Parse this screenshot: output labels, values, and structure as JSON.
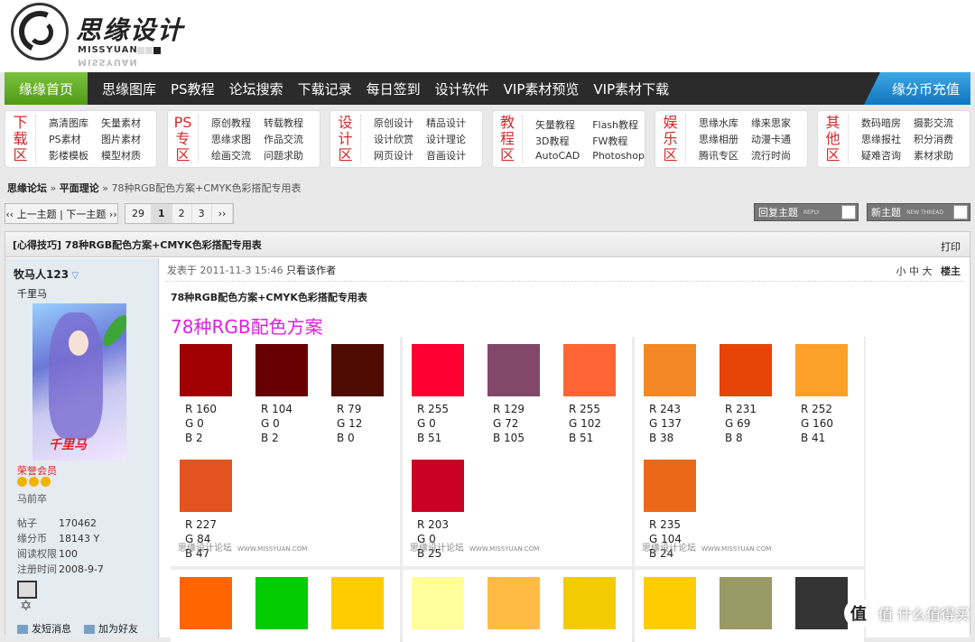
{
  "logo": {
    "cn": "思缘设计",
    "en": "MISSYUAN"
  },
  "nav": {
    "home": "缘缘首页",
    "items": [
      "思缘图库",
      "PS教程",
      "论坛搜索",
      "下载记录",
      "每日签到",
      "设计软件",
      "VIP素材预览",
      "VIP素材下载"
    ],
    "recharge": "缘分币充值"
  },
  "subnav": [
    {
      "title": [
        "下",
        "载",
        "区"
      ],
      "links": [
        "高清图库",
        "矢量素材",
        "PS素材",
        "图片素材",
        "影楼模板",
        "模型材质"
      ]
    },
    {
      "title": [
        "PS",
        "专",
        "区"
      ],
      "links": [
        "原创教程",
        "转载教程",
        "思缘求图",
        "作品交流",
        "绘画交流",
        "问题求助"
      ]
    },
    {
      "title": [
        "设",
        "计",
        "区"
      ],
      "links": [
        "原创设计",
        "精品设计",
        "设计欣赏",
        "设计理论",
        "网页设计",
        "音画设计"
      ]
    },
    {
      "title": [
        "教",
        "程",
        "区"
      ],
      "links": [
        "矢量教程",
        "Flash教程",
        "3D教程",
        "FW教程",
        "AutoCAD",
        "Photoshop"
      ]
    },
    {
      "title": [
        "娱",
        "乐",
        "区"
      ],
      "links": [
        "思缘水库",
        "缘来思家",
        "思缘相册",
        "动漫卡通",
        "腾讯专区",
        "流行时尚"
      ]
    },
    {
      "title": [
        "其",
        "他",
        "区"
      ],
      "links": [
        "数码暗房",
        "摄影交流",
        "思缘报社",
        "积分消费",
        "疑难咨询",
        "素材求助"
      ]
    }
  ],
  "breadcrumb": {
    "root": "思缘论坛",
    "sep": "»",
    "section": "平面理论",
    "current": "78种RGB配色方案+CMYK色彩搭配专用表"
  },
  "pager": {
    "prevnext": "‹‹ 上一主题 | 下一主题 ››",
    "pages": [
      "29",
      "1",
      "2",
      "3",
      "››"
    ],
    "reply": "回复主题",
    "reply_en": "REPLY",
    "newthread": "新主题",
    "newthread_en": "NEW THREAD"
  },
  "thread": {
    "title": "[心得技巧] 78种RGB配色方案+CMYK色彩搭配专用表",
    "print": "打印"
  },
  "user": {
    "name": "牧马人123",
    "title": "千里马",
    "signature_art": "千里马",
    "rank": "荣誉会员",
    "rank2": "马前卒",
    "stats": [
      {
        "k": "帖子",
        "v": "170462"
      },
      {
        "k": "缘分币",
        "v": "18143 Y"
      },
      {
        "k": "阅读权限",
        "v": "100"
      },
      {
        "k": "注册时间",
        "v": "2008-9-7"
      }
    ],
    "pm": "发短消息",
    "addfriend": "加为好友"
  },
  "post": {
    "meta": "发表于 2011-11-3 15:46",
    "author_only": "只看该作者",
    "font_sizes": [
      "小",
      "中",
      "大"
    ],
    "floor": "楼主",
    "subject": "78种RGB配色方案+CMYK色彩搭配专用表",
    "heading": "78种RGB配色方案",
    "watermark": "思缘设计论坛",
    "watermark_en": "WWW.MISSYUAN.COM"
  },
  "swatches": [
    {
      "panel": 0,
      "color": "#a00002",
      "r": "R 160",
      "g": "G 0",
      "b": "B 2"
    },
    {
      "panel": 0,
      "color": "#680002",
      "r": "R 104",
      "g": "G 0",
      "b": "B 2"
    },
    {
      "panel": 0,
      "color": "#4f0c00",
      "r": "R 79",
      "g": "G 12",
      "b": "B 0"
    },
    {
      "panel": 0,
      "color": "#e35421",
      "r": "R 227",
      "g": "G 84",
      "b": "B 47"
    },
    {
      "panel": 1,
      "color": "#ff0033",
      "r": "R 255",
      "g": "G 0",
      "b": "B 51"
    },
    {
      "panel": 1,
      "color": "#814869",
      "r": "R 129",
      "g": "G 72",
      "b": "B 105"
    },
    {
      "panel": 1,
      "color": "#ff6633",
      "r": "R 255",
      "g": "G 102",
      "b": "B 51"
    },
    {
      "panel": 1,
      "color": "#cb0025",
      "r": "R 203",
      "g": "G 0",
      "b": "B 25"
    },
    {
      "panel": 2,
      "color": "#f38926",
      "r": "R 243",
      "g": "G 137",
      "b": "B 38"
    },
    {
      "panel": 2,
      "color": "#e74508",
      "r": "R 231",
      "g": "G 69",
      "b": "B 8"
    },
    {
      "panel": 2,
      "color": "#fca029",
      "r": "R 252",
      "g": "G 160",
      "b": "B 41"
    },
    {
      "panel": 2,
      "color": "#eb6818",
      "r": "R 235",
      "g": "G 104",
      "b": "B 24"
    }
  ],
  "swatches_row2": [
    "#ff6600",
    "#00cc00",
    "#ffcc00",
    "#ffff99",
    "#ffbb44",
    "#f2cc00",
    "#ffcc00",
    "#999966",
    "#333333"
  ],
  "corner": {
    "text": "值 什么值得买",
    "icon": "值"
  }
}
